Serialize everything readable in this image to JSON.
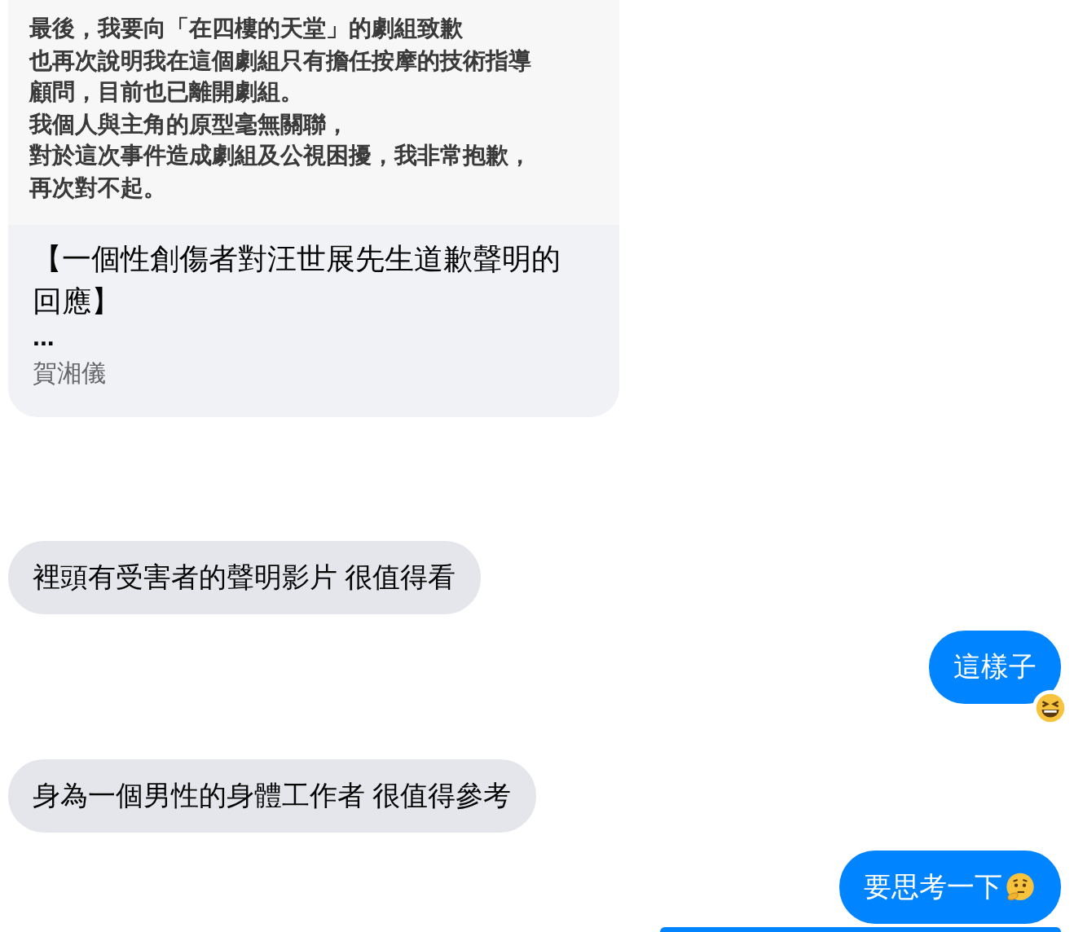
{
  "shared_post": {
    "image_lines": [
      "最後，我要向「在四樓的天堂」的劇組致歉",
      "也再次說明我在這個劇組只有擔任按摩的技術指導",
      "顧問，目前也已離開劇組。",
      "我個人與主角的原型毫無關聯，",
      "對於這次事件造成劇組及公視困擾，我非常抱歉，",
      "再次對不起。"
    ],
    "title": "【一個性創傷者對汪世展先生道歉聲明的回應】",
    "excerpt": "...",
    "author": "賀湘儀"
  },
  "messages": [
    {
      "kind": "received",
      "text": "裡頭有受害者的聲明影片 很值得看"
    },
    {
      "kind": "sent",
      "text": "這樣子",
      "reaction": {
        "kind": "laughing"
      }
    },
    {
      "kind": "received",
      "text": "身為一個男性的身體工作者 很值得參考"
    },
    {
      "kind": "sent",
      "text": "要思考一下",
      "emoji": {
        "kind": "thinking"
      }
    }
  ]
}
